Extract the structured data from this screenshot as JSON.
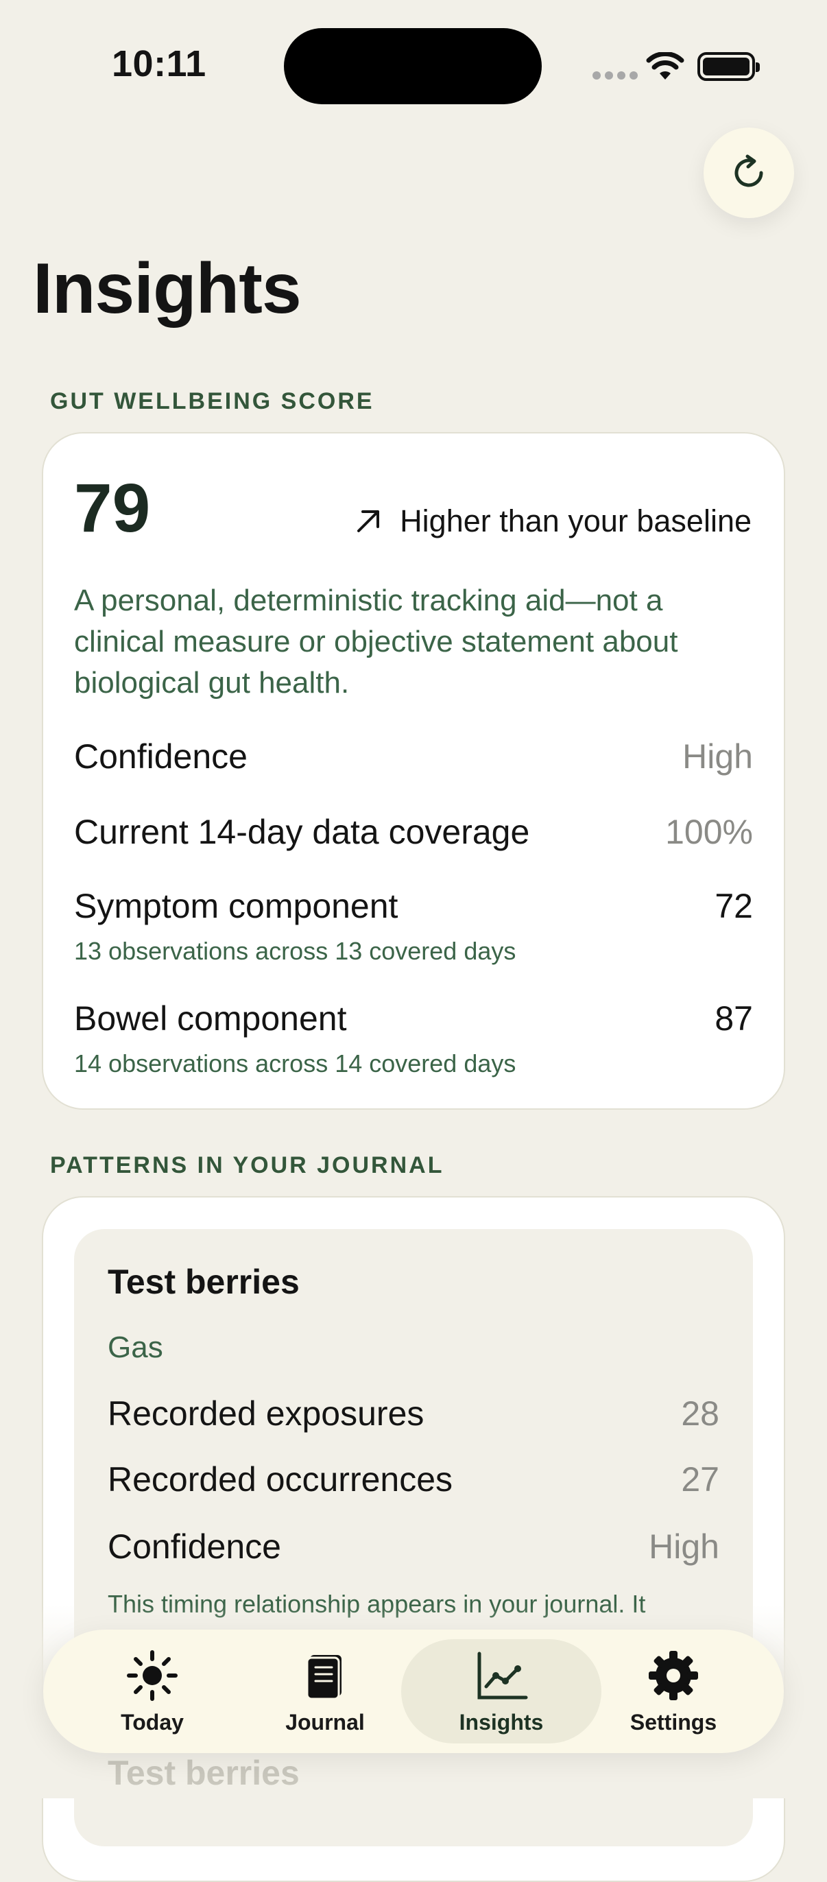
{
  "status_bar": {
    "time": "10:11"
  },
  "page": {
    "title": "Insights"
  },
  "score_section": {
    "label": "GUT WELLBEING SCORE",
    "score": "79",
    "trend": "Higher than your baseline",
    "disclaimer": "A personal, deterministic tracking aid—not a clinical measure or objective statement about biological gut health.",
    "rows": [
      {
        "label": "Confidence",
        "value": "High"
      },
      {
        "label": "Current 14-day data coverage",
        "value": "100%"
      },
      {
        "label": "Symptom component",
        "value": "72",
        "note": "13 observations across 13 covered days"
      },
      {
        "label": "Bowel component",
        "value": "87",
        "note": "14 observations across 14 covered days"
      }
    ]
  },
  "patterns_section": {
    "label": "PATTERNS IN YOUR JOURNAL",
    "items": [
      {
        "title": "Test berries",
        "symptom": "Gas",
        "rows": [
          {
            "label": "Recorded exposures",
            "value": "28"
          },
          {
            "label": "Recorded occurrences",
            "value": "27"
          },
          {
            "label": "Confidence",
            "value": "High"
          }
        ],
        "note": "This timing relationship appears in your journal. It"
      },
      {
        "title": "Test berries"
      }
    ]
  },
  "tab_bar": {
    "tabs": [
      {
        "label": "Today",
        "icon": "sun-icon"
      },
      {
        "label": "Journal",
        "icon": "journal-icon"
      },
      {
        "label": "Insights",
        "icon": "chart-line-icon",
        "active": true
      },
      {
        "label": "Settings",
        "icon": "gear-icon"
      }
    ]
  }
}
